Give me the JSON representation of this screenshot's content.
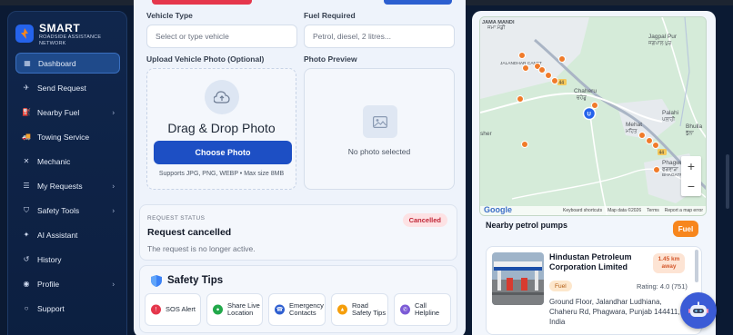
{
  "brand": {
    "title": "SMART",
    "subtitle": "ROADSIDE ASSISTANCE NETWORK"
  },
  "sidebar": {
    "items": [
      {
        "label": "Dashboard",
        "icon": "grid-icon",
        "active": true,
        "chevron": false
      },
      {
        "label": "Send Request",
        "icon": "send-icon",
        "active": false,
        "chevron": false
      },
      {
        "label": "Nearby Fuel",
        "icon": "fuel-icon",
        "active": false,
        "chevron": true
      },
      {
        "label": "Towing Service",
        "icon": "tow-truck-icon",
        "active": false,
        "chevron": false
      },
      {
        "label": "Mechanic",
        "icon": "wrench-icon",
        "active": false,
        "chevron": false
      },
      {
        "label": "My Requests",
        "icon": "list-icon",
        "active": false,
        "chevron": true
      },
      {
        "label": "Safety Tools",
        "icon": "shield-icon",
        "active": false,
        "chevron": true
      },
      {
        "label": "AI Assistant",
        "icon": "sparkle-icon",
        "active": false,
        "chevron": false
      },
      {
        "label": "History",
        "icon": "history-icon",
        "active": false,
        "chevron": false
      },
      {
        "label": "Profile",
        "icon": "profile-icon",
        "active": false,
        "chevron": true
      },
      {
        "label": "Support",
        "icon": "support-icon",
        "active": false,
        "chevron": false
      }
    ]
  },
  "form": {
    "vehicle_type_label": "Vehicle Type",
    "vehicle_type_placeholder": "Select or type vehicle",
    "fuel_label": "Fuel Required",
    "fuel_placeholder": "Petrol, diesel, 2 litres...",
    "upload_label": "Upload Vehicle Photo (Optional)",
    "preview_label": "Photo Preview",
    "upload_title": "Drag & Drop Photo",
    "choose_button": "Choose Photo",
    "upload_hint": "Supports JPG, PNG, WEBP • Max size 8MB",
    "preview_empty": "No photo selected"
  },
  "status": {
    "label": "REQUEST STATUS",
    "title": "Request cancelled",
    "description": "The request is no longer active.",
    "badge": "Cancelled",
    "badge_color": "#c02637"
  },
  "safety": {
    "title": "Safety Tips",
    "tips": [
      {
        "label": "SOS Alert",
        "icon": "sos-icon",
        "color": "#e5374c"
      },
      {
        "label": "Share Live Location",
        "icon": "location-icon",
        "color": "#22a84a"
      },
      {
        "label": "Emergency Contacts",
        "icon": "contacts-icon",
        "color": "#2f5fd0"
      },
      {
        "label": "Road Safety Tips",
        "icon": "warning-icon",
        "color": "#f59e0b"
      },
      {
        "label": "Call Helpline",
        "icon": "phone-icon",
        "color": "#7c5bd6"
      }
    ]
  },
  "map": {
    "places": [
      "JAMA MANDI",
      "Jagpal Pur",
      "JALANDHAR CANTT",
      "Chaheru",
      "Palahi",
      "Mehat",
      "Bhulla",
      "Phagwara",
      "BHAGATPURA",
      "sher"
    ],
    "places_local": [
      "ਜਮਾ ਮੰਡੀ",
      "ਜਗਪਾਲ ਪੁਰ",
      "ਚਹੇੜੂ",
      "ਪਲਾਹੀ",
      "ਮਹਿਤ",
      "ਭੁੱਲਾ",
      "ਫਗਵਾੜਾ"
    ],
    "road_shields": [
      "44",
      "44"
    ],
    "footer": [
      "Keyboard shortcuts",
      "Map data ©2026",
      "Terms",
      "Report a map error"
    ],
    "google": "Google",
    "zoom_in": "+",
    "zoom_out": "−"
  },
  "pumps": {
    "title": "Nearby petrol pumps",
    "filter_button": "Fuel",
    "items": [
      {
        "name": "Hindustan Petroleum Corporation Limited",
        "distance": "1.45 km away",
        "type": "Fuel",
        "rating": "Rating: 4.0 (751)",
        "address": "Ground Floor, Jalandhar Ludhiana, Chaheru Rd, Phagwara, Punjab 144411, India"
      }
    ]
  },
  "colors": {
    "accent": "#1d4fc4",
    "sidebar_bg": "#10264c",
    "orange": "#f7861d"
  }
}
